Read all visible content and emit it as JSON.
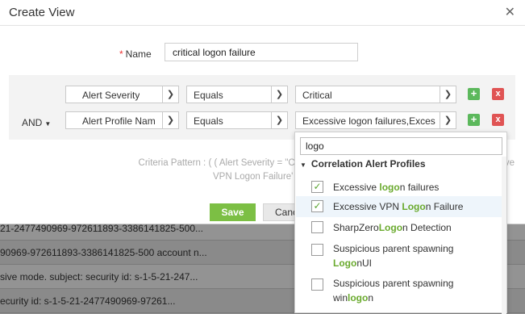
{
  "background_rows": [
    "21-2477490969-972611893-3386141825-500...",
    "90969-972611893-3386141825-500 account n...",
    "sive mode. subject: security id: s-1-5-21-247...",
    "ecurity id: s-1-5-21-2477490969-97261..."
  ],
  "modal": {
    "title": "Create View",
    "close_icon": "close-icon"
  },
  "name_field": {
    "required_mark": "*",
    "label": "Name",
    "value": "critical logon failure"
  },
  "criteria": {
    "operator": "AND",
    "rows": [
      {
        "field": "Alert Severity",
        "condition": "Equals",
        "value": "Critical"
      },
      {
        "field": "Alert Profile Nam",
        "condition": "Equals",
        "value": "Excessive logon failures,Exces"
      }
    ],
    "add_icon": "+",
    "delete_icon": "x"
  },
  "pattern": {
    "line1": "Criteria Pattern : ( ( Alert Severity = \"Critical\" ) AND ( Alert Pr",
    "line1_tail": "ve",
    "line2": "VPN Logon Failure'"
  },
  "buttons": {
    "save": "Save",
    "cancel": "Cance"
  },
  "dropdown": {
    "search_value": "logo",
    "group_label": "Correlation Alert Profiles",
    "items": [
      {
        "pre": "Excessive ",
        "hit": "logo",
        "post": "n failures",
        "checked": true
      },
      {
        "pre": "Excessive VPN ",
        "hit": "Logo",
        "post": "n Failure",
        "checked": true
      },
      {
        "pre": "SharpZero",
        "hit": "Logo",
        "post": "n Detection",
        "checked": false
      },
      {
        "line1": "Suspicious parent spawning",
        "hit": "Logo",
        "post": "nUI",
        "checked": false
      },
      {
        "line1": "Suspicious parent spawning",
        "pre": "win",
        "hit": "logo",
        "post": "n",
        "checked": false
      }
    ]
  },
  "colors": {
    "accent_green": "#7cbf44",
    "highlight_green": "#6aaa2e",
    "delete_red": "#e05454"
  }
}
